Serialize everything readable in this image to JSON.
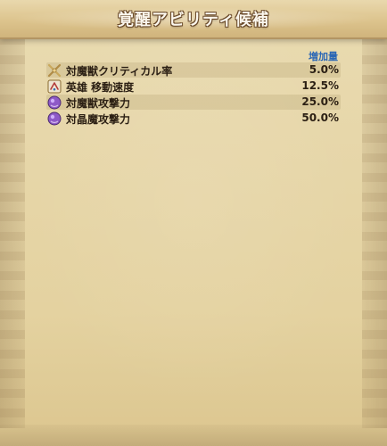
{
  "title": "覚醒アビリティ候補",
  "table": {
    "header_right": "増加量",
    "rows": [
      {
        "icon": "crossed-swords-icon",
        "label": "対魔獣クリティカル率",
        "value": "5.0%"
      },
      {
        "icon": "hero-card-icon",
        "label": "英雄 移動速度",
        "value": "12.5%"
      },
      {
        "icon": "purple-orb-icon",
        "label": "対魔獣攻撃力",
        "value": "25.0%"
      },
      {
        "icon": "purple-orb-icon",
        "label": "対晶魔攻撃力",
        "value": "50.0%"
      }
    ]
  }
}
